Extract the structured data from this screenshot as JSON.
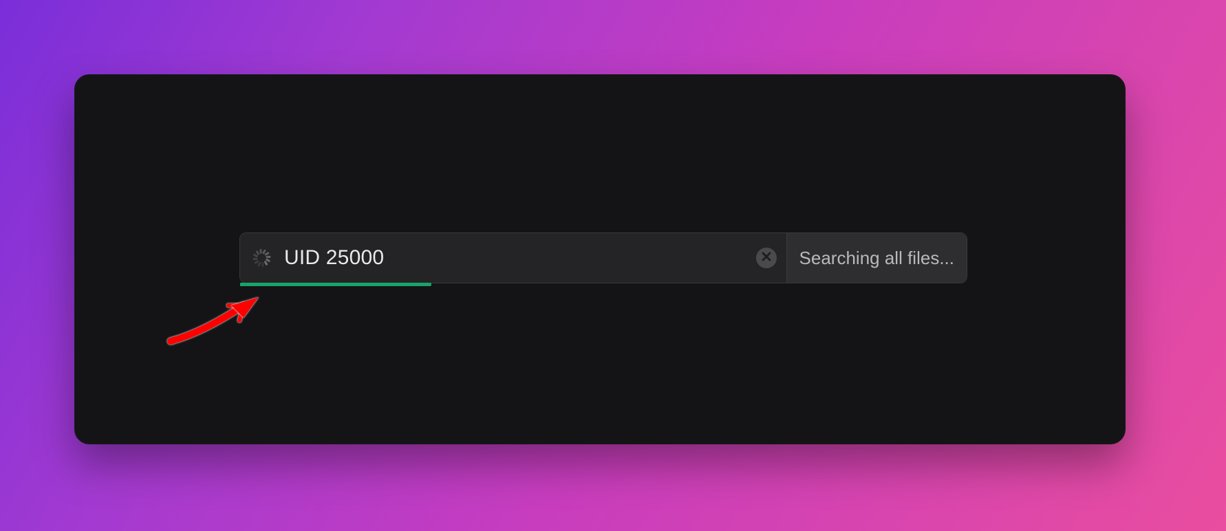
{
  "search": {
    "query": "UID 25000",
    "placeholder": "",
    "scope_label": "Searching all files...",
    "progress_percent": 35
  },
  "colors": {
    "progress": "#18a36a",
    "window_bg": "#141416",
    "annotation": "#ff0000"
  }
}
